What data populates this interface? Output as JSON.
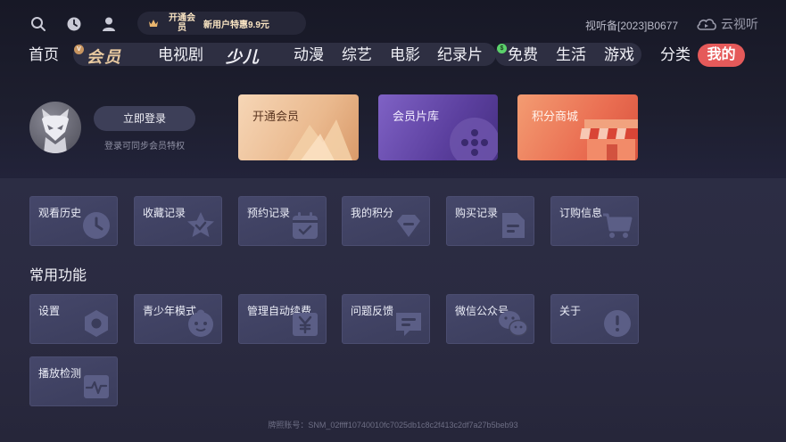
{
  "top": {
    "promo_open": "开通会员",
    "promo_deal": "新用户特惠9.9元",
    "license": "视听备[2023]B0677",
    "brand": "云视听"
  },
  "nav": {
    "home": "首页",
    "vip": "会员",
    "tv": "电视剧",
    "kids": "少儿",
    "anime": "动漫",
    "variety": "综艺",
    "movie": "电影",
    "documentary": "纪录片",
    "free": "免费",
    "life": "生活",
    "game": "游戏",
    "category": "分类",
    "mine": "我的"
  },
  "profile": {
    "login_label": "立即登录",
    "login_hint": "登录可同步会员特权"
  },
  "cards": [
    {
      "title": "开通会员"
    },
    {
      "title": "会员片库"
    },
    {
      "title": "积分商城"
    }
  ],
  "records": [
    {
      "label": "观看历史",
      "icon": "clock-icon"
    },
    {
      "label": "收藏记录",
      "icon": "star-icon"
    },
    {
      "label": "预约记录",
      "icon": "calendar-icon"
    },
    {
      "label": "我的积分",
      "icon": "diamond-icon"
    },
    {
      "label": "购买记录",
      "icon": "document-icon"
    },
    {
      "label": "订购信息",
      "icon": "cart-icon"
    }
  ],
  "functions_title": "常用功能",
  "functions": [
    {
      "label": "设置",
      "icon": "settings-icon"
    },
    {
      "label": "青少年模式",
      "icon": "child-icon"
    },
    {
      "label": "管理自动续费",
      "icon": "yen-icon"
    },
    {
      "label": "问题反馈",
      "icon": "feedback-icon"
    },
    {
      "label": "微信公众号",
      "icon": "wechat-icon"
    },
    {
      "label": "关于",
      "icon": "info-icon"
    },
    {
      "label": "播放检测",
      "icon": "pulse-icon"
    }
  ],
  "footer": "牌照账号：SNM_02ffff10740010fc7025db1c8c2f413c2df7a27b5beb93",
  "colors": {
    "accent_red": "#e55a5a",
    "vip_gold": "#e8c9a0",
    "tile_bg": "#41435f"
  }
}
